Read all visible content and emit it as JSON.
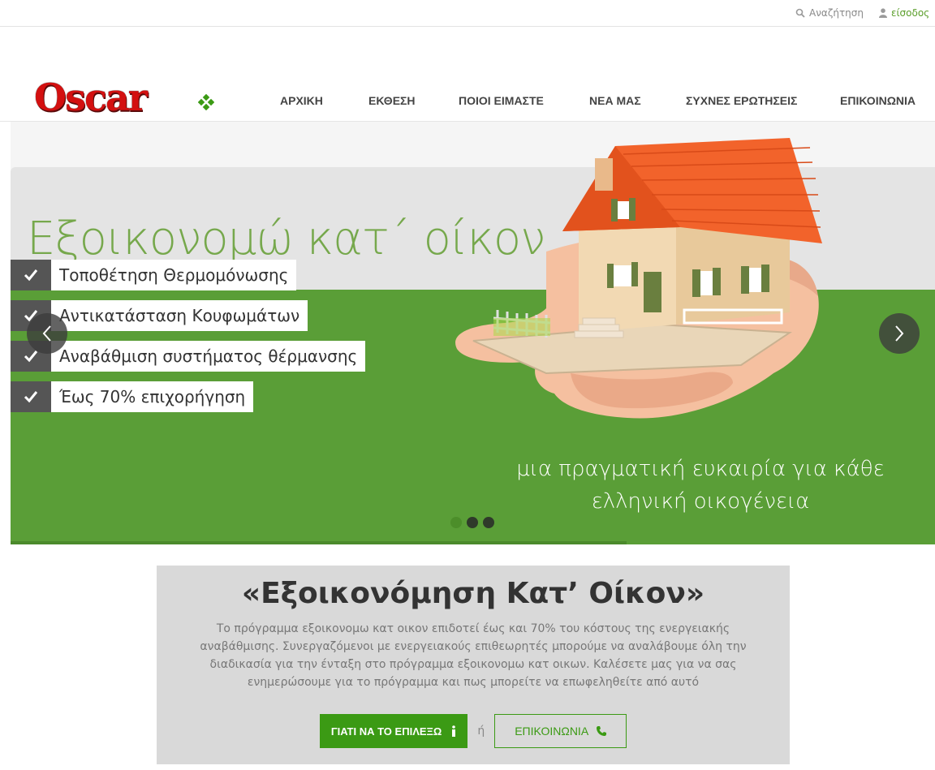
{
  "topbar": {
    "search_label": "Αναζήτηση",
    "login_label": "είσοδος"
  },
  "logo": {
    "text": "Oscar",
    "brand_color": "#d31010"
  },
  "nav": {
    "items": [
      "ΑΡΧΙΚΗ",
      "ΕΚΘΕΣΗ",
      "ΠΟΙΟΙ ΕΙΜΑΣΤΕ",
      "ΝΕΑ ΜΑΣ",
      "ΣΥΧΝΕΣ ΕΡΩΤΗΣΕΙΣ",
      "ΕΠΙΚΟΙΝΩΝΙΑ"
    ]
  },
  "hero": {
    "title": "Εξοικονομώ κατ΄ οίκον",
    "checks": [
      "Τοποθέτηση Θερμομόνωσης",
      "Αντικατάσταση Κουφωμάτων",
      "Αναβάθμιση συστήματος θέρμανσης",
      "Έως 70% επιχορήγηση"
    ],
    "tagline_line1": "μια πραγματική ευκαιρία για κάθε",
    "tagline_line2": "ελληνική οικογένεια",
    "slide_count": 3,
    "active_slide": 1,
    "accent_green": "#5a9e37"
  },
  "info": {
    "heading": "«Εξοικονόμηση Κατ’ Οίκον»",
    "body": "Το πρόγραμμα εξοικονομω κατ οικον επιδοτεί έως και 70% του κόστους της ενεργειακής αναβάθμισης. Συνεργαζόμενοι με ενεργειακούς επιθεωρητές μπορούμε να αναλάβουμε όλη την διαδικασία για την ένταξη στο πρόγραμμα εξοικονομω κατ οικων. Καλέσετε μας για να σας ενημερώσουμε για το πρόγραμμα και πως μπορείτε να επωφεληθείτε από αυτό",
    "primary_button": "ΓΙΑΤΙ ΝΑ ΤΟ ΕΠΙΛΕΞΩ",
    "or_text": "ή",
    "secondary_button": "ΕΠΙΚΟΙΝΩΝΙΑ",
    "button_color": "#3b9a14"
  }
}
